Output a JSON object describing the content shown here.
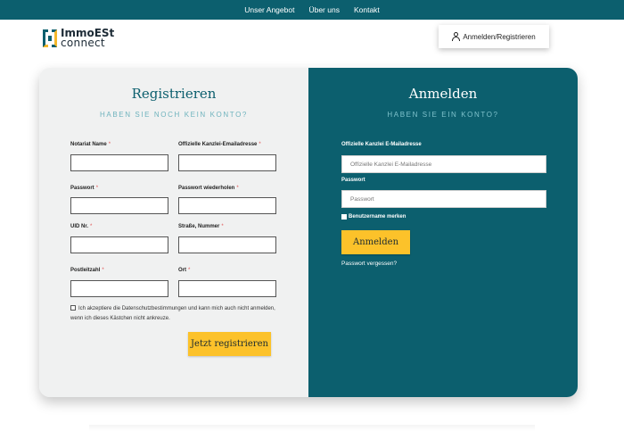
{
  "nav": {
    "items": [
      "Unser Angebot",
      "Über uns",
      "Kontakt"
    ]
  },
  "logo": {
    "line1": "ImmoESt",
    "line2": "connect"
  },
  "header": {
    "login_button": "Anmelden/Registrieren",
    "login_icon": "user-icon"
  },
  "register": {
    "title": "Registrieren",
    "subtitle": "HABEN SIE NOCH KEIN KONTO?",
    "fields": [
      {
        "label": "Notariat Name",
        "required": "*",
        "value": ""
      },
      {
        "label": "Offizielle Kanzlei-Emailadresse",
        "required": "*",
        "value": ""
      },
      {
        "label": "Passwort",
        "required": "*",
        "value": ""
      },
      {
        "label": "Passwort wiederholen",
        "required": "*",
        "value": ""
      },
      {
        "label": "UID Nr.",
        "required": "*",
        "value": ""
      },
      {
        "label": "Straße, Nummer",
        "required": "*",
        "value": ""
      },
      {
        "label": "Postleitzahl",
        "required": "*",
        "value": ""
      },
      {
        "label": "Ort",
        "required": "*",
        "value": ""
      }
    ],
    "terms_text": "Ich akzeptiere die Datenschutzbestimmungen und kann mich auch nicht anmelden, wenn ich dieses Kästchen nicht ankreuze.",
    "submit_label": "Jetzt registrieren"
  },
  "login": {
    "title": "Anmelden",
    "subtitle": "HABEN SIE EIN KONTO?",
    "email_label": "Offizielle Kanzlei E-Mailadresse",
    "email_placeholder": "Offizielle Kanzlei E-Mailadresse",
    "password_label": "Passwort",
    "password_placeholder": "Passwort",
    "remember_label": "Benutzername merken",
    "submit_label": "Anmelden",
    "forgot_label": "Passwort vergessen?"
  },
  "colors": {
    "primary": "#0c5f6e",
    "accent": "#fcc22a",
    "panel": "#f0f1f1"
  }
}
